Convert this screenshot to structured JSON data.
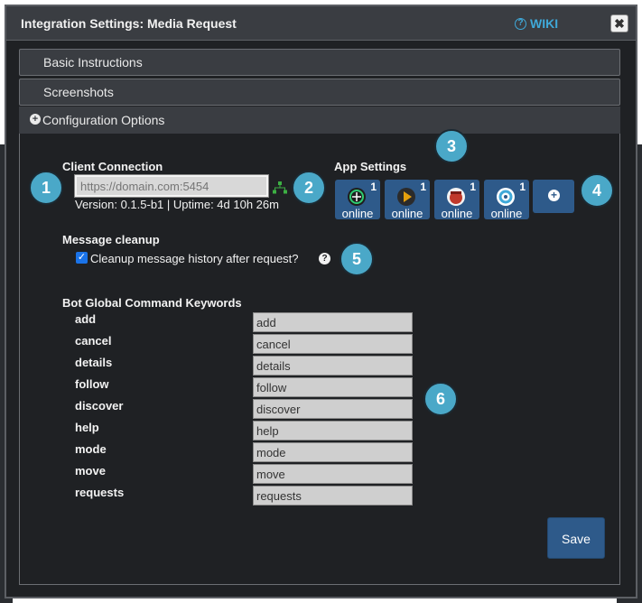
{
  "dialog": {
    "title": "Integration Settings: Media Request",
    "wiki_label": "WIKI",
    "close_symbol": "✖"
  },
  "accordion": {
    "basic_instructions": "Basic Instructions",
    "screenshots": "Screenshots",
    "configuration_options": "Configuration Options"
  },
  "client_connection": {
    "heading": "Client Connection",
    "placeholder": "https://domain.com:5454",
    "version_line": "Version: 0.1.5-b1 | Uptime: 4d 10h 26m"
  },
  "app_settings": {
    "heading": "App Settings",
    "apps": [
      {
        "icon": "sonarr-icon",
        "count": "1",
        "status": "online"
      },
      {
        "icon": "plex-play-icon",
        "count": "1",
        "status": "online"
      },
      {
        "icon": "radarr-icon",
        "count": "1",
        "status": "online"
      },
      {
        "icon": "overseerr-icon",
        "count": "1",
        "status": "online"
      }
    ]
  },
  "message_cleanup": {
    "heading": "Message cleanup",
    "checkbox_label": "Cleanup message history after request?",
    "checked": true
  },
  "keywords": {
    "heading": "Bot Global Command Keywords",
    "rows": [
      {
        "label": "add",
        "value": "add"
      },
      {
        "label": "cancel",
        "value": "cancel"
      },
      {
        "label": "details",
        "value": "details"
      },
      {
        "label": "follow",
        "value": "follow"
      },
      {
        "label": "discover",
        "value": "discover"
      },
      {
        "label": "help",
        "value": "help"
      },
      {
        "label": "mode",
        "value": "mode"
      },
      {
        "label": "move",
        "value": "move"
      },
      {
        "label": "requests",
        "value": "requests"
      }
    ]
  },
  "badges": [
    "1",
    "2",
    "3",
    "4",
    "5",
    "6"
  ],
  "save_label": "Save",
  "colors": {
    "accent": "#2e5a8a",
    "badge": "#4aa8c8",
    "wiki": "#3fa9d9"
  }
}
